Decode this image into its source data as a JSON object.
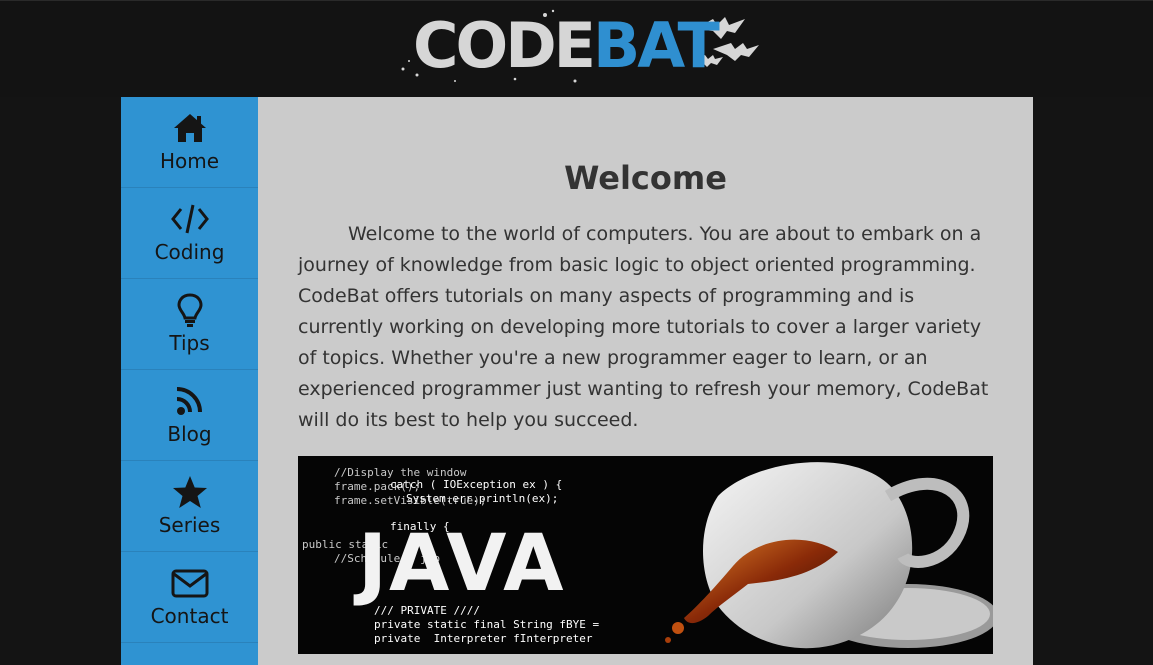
{
  "header": {
    "logo": {
      "code": "CODE",
      "bat": "BAT"
    }
  },
  "sidebar": {
    "items": [
      {
        "label": "Home",
        "icon": "home-icon"
      },
      {
        "label": "Coding",
        "icon": "code-icon"
      },
      {
        "label": "Tips",
        "icon": "lightbulb-icon"
      },
      {
        "label": "Blog",
        "icon": "rss-icon"
      },
      {
        "label": "Series",
        "icon": "star-icon"
      },
      {
        "label": "Contact",
        "icon": "envelope-icon"
      }
    ]
  },
  "main": {
    "title": "Welcome",
    "paragraph": "Welcome to the world of computers. You are about to embark on a journey of knowledge from basic logic to object oriented programming. CodeBat offers tutorials on many aspects of programming and is currently working on developing more tutorials to cover a larger variety of topics. Whether you're a new programmer eager to learn, or an experienced programmer just wanting to refresh your memory, CodeBat will do its best to help you succeed.",
    "banner": {
      "word": "JAVA",
      "code_lines": [
        "//Display the window",
        "frame.pack();",
        "frame.setVisible(true);",
        "catch ( IOException ex ) {",
        "System.err.println(ex);",
        "finally {",
        "public static",
        "//Schedule a job",
        "/// PRIVATE ////",
        "private static final String fBYE =",
        "private  Interpreter fInterpreter"
      ]
    }
  },
  "colors": {
    "header_bg": "#131313",
    "sidebar_bg": "#2f93d2",
    "content_bg": "#cbcbcb",
    "logo_accent": "#2f8fd0"
  }
}
